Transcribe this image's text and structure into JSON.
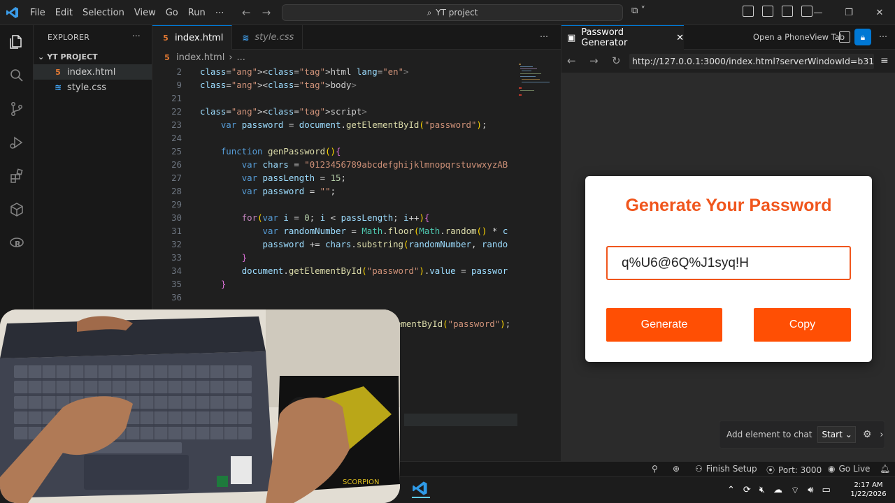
{
  "titlebar": {
    "menu": [
      "File",
      "Edit",
      "Selection",
      "View",
      "Go",
      "Run",
      "⋯"
    ],
    "search": "YT project"
  },
  "sidebar": {
    "title": "EXPLORER",
    "more": "⋯",
    "project": "YT PROJECT",
    "files": [
      {
        "name": "index.html",
        "type": "html"
      },
      {
        "name": "style.css",
        "type": "css"
      }
    ]
  },
  "editor": {
    "tabs": [
      {
        "label": "index.html",
        "active": true
      },
      {
        "label": "style.css",
        "active": false
      }
    ],
    "breadcrumb": [
      "index.html",
      "..."
    ],
    "lines": [
      {
        "n": "2",
        "text": "<html lang=\"en\">"
      },
      {
        "n": "9",
        "text": "<body>"
      },
      {
        "n": "21",
        "text": ""
      },
      {
        "n": "22",
        "text": "<script>"
      },
      {
        "n": "23",
        "text": "    var password = document.getElementById(\"password\");"
      },
      {
        "n": "24",
        "text": ""
      },
      {
        "n": "25",
        "text": "    function genPassword(){"
      },
      {
        "n": "26",
        "text": "        var chars = \"0123456789abcdefghijklmnopqrstuvwxyzAB"
      },
      {
        "n": "27",
        "text": "        var passLength = 15;"
      },
      {
        "n": "28",
        "text": "        var password = \"\";"
      },
      {
        "n": "29",
        "text": ""
      },
      {
        "n": "30",
        "text": "        for(var i = 0; i < passLength; i++){"
      },
      {
        "n": "31",
        "text": "            var randomNumber = Math.floor(Math.random() * c"
      },
      {
        "n": "32",
        "text": "            password += chars.substring(randomNumber, rando"
      },
      {
        "n": "33",
        "text": "        }"
      },
      {
        "n": "34",
        "text": "        document.getElementById(\"password\").value = passwor"
      },
      {
        "n": "35",
        "text": "    }"
      },
      {
        "n": "36",
        "text": ""
      }
    ],
    "partial_line": "ementById(\"password\");"
  },
  "browser": {
    "tab_title": "Password Generator",
    "phone_view": "Open a PhoneView Tab",
    "url": "http://127.0.0.1:3000/index.html?serverWindowId=b31991",
    "page": {
      "heading": "Generate Your Password",
      "password_value": "q%U6@6Q%J1syq!H",
      "generate_label": "Generate",
      "copy_label": "Copy"
    },
    "chat": {
      "label": "Add element to chat",
      "start": "Start"
    }
  },
  "status": {
    "finish_setup": "Finish Setup",
    "port": "Port: 3000",
    "go_live": "Go Live"
  },
  "taskbar": {
    "time": "2:17 AM",
    "date": "1/22/2026"
  },
  "colors": {
    "accent": "#0078d4",
    "brand_orange": "#f0561d",
    "button_orange": "#ff4f04"
  }
}
